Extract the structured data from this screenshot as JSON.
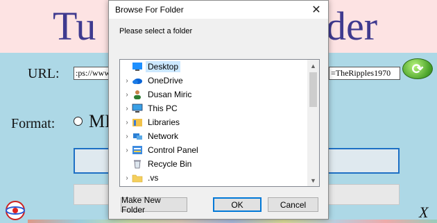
{
  "app": {
    "title_left": "Tu",
    "title_right": "der",
    "url_label": "URL:",
    "url_value_left": ":ps://www",
    "url_value_right": "=TheRipples1970",
    "refresh_icon": "refresh-icon",
    "format_label": "Format:",
    "format_option": "MI",
    "close_label": "X",
    "logo_icon": "app-logo-icon"
  },
  "dialog": {
    "title": "Browse For Folder",
    "close_glyph": "✕",
    "prompt": "Please select a folder",
    "tree": [
      {
        "label": "Desktop",
        "icon": "desktop-icon",
        "expandable": false,
        "selected": true
      },
      {
        "label": "OneDrive",
        "icon": "onedrive-icon",
        "expandable": true,
        "selected": false
      },
      {
        "label": "Dusan Miric",
        "icon": "user-icon",
        "expandable": true,
        "selected": false
      },
      {
        "label": "This PC",
        "icon": "computer-icon",
        "expandable": true,
        "selected": false
      },
      {
        "label": "Libraries",
        "icon": "libraries-icon",
        "expandable": true,
        "selected": false
      },
      {
        "label": "Network",
        "icon": "network-icon",
        "expandable": true,
        "selected": false
      },
      {
        "label": "Control Panel",
        "icon": "control-panel-icon",
        "expandable": true,
        "selected": false
      },
      {
        "label": "Recycle Bin",
        "icon": "recycle-bin-icon",
        "expandable": false,
        "selected": false
      },
      {
        "label": ".vs",
        "icon": "folder-icon",
        "expandable": true,
        "selected": false
      }
    ],
    "buttons": {
      "make_new_folder": "Make New Folder",
      "ok": "OK",
      "cancel": "Cancel"
    }
  }
}
